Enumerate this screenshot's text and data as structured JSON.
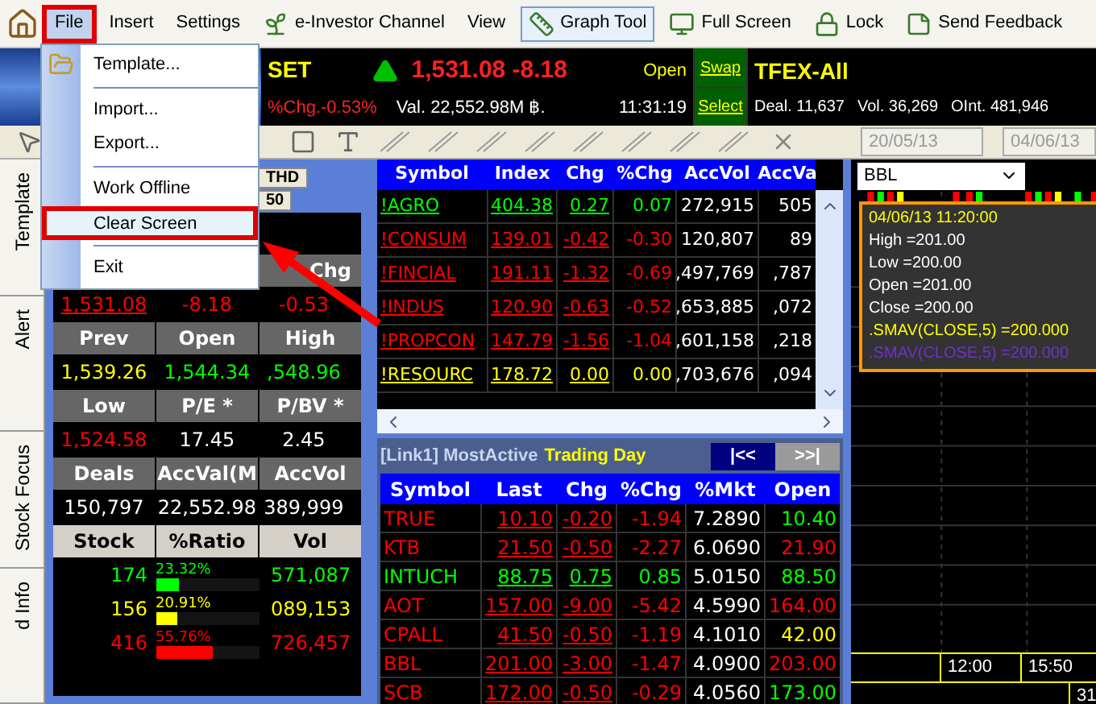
{
  "menu_bar": [
    {
      "label": "File",
      "selected": true,
      "toggled": false
    },
    {
      "label": "Insert",
      "selected": false,
      "toggled": false
    },
    {
      "label": "Settings",
      "selected": false,
      "toggled": false
    },
    {
      "label": "e-Investor Channel",
      "selected": false,
      "toggled": false
    },
    {
      "label": "View",
      "selected": false,
      "toggled": false
    },
    {
      "label": "Graph Tool",
      "selected": false,
      "toggled": true
    },
    {
      "label": "Full Screen",
      "selected": false,
      "toggled": false
    },
    {
      "label": "Lock",
      "selected": false,
      "toggled": false
    },
    {
      "label": "Send Feedback",
      "selected": false,
      "toggled": false
    }
  ],
  "file_menu": [
    {
      "label": "Template...",
      "separator_before": false,
      "highlighted": false
    },
    {
      "label": "Import...",
      "separator_before": true,
      "highlighted": false
    },
    {
      "label": "Export...",
      "separator_before": false,
      "highlighted": false
    },
    {
      "label": "Work Offline",
      "separator_before": true,
      "highlighted": false
    },
    {
      "label": "Clear Screen",
      "separator_before": false,
      "highlighted": true
    },
    {
      "label": "Exit",
      "separator_before": true,
      "highlighted": false
    }
  ],
  "market": {
    "index_name": "SET",
    "last": "1,531.08 -8.18",
    "status": "Open",
    "pct_change": "%Chg.-0.53%",
    "value": "Val. 22,552.98M ฿.",
    "time": "11:31:19",
    "swap": "Swap",
    "select": "Select",
    "tfex_name": "TFEX-All",
    "deal": "Deal. 11,637",
    "volume": "Vol. 36,269",
    "open_interest": "OInt. 481,946"
  },
  "toolbar": {
    "date_from": "20/05/13",
    "date_to": "04/06/13"
  },
  "side_tabs": [
    "Template",
    "Alert",
    "Stock Focus",
    "d Info"
  ],
  "left_panel": {
    "tabs": [
      "THD",
      "50"
    ],
    "sections": [
      {
        "headers": [
          "Chg"
        ],
        "values": [
          {
            "text": "1,531.08",
            "color": "#ff0000",
            "underlined": true
          },
          {
            "text": "-8.18",
            "color": "#ff0000",
            "underlined": false
          },
          {
            "text": "-0.53",
            "color": "#ff0000",
            "underlined": false
          }
        ]
      },
      {
        "headers": [
          "Prev",
          "Open",
          "High"
        ],
        "values": [
          {
            "text": "1,539.26",
            "color": "#ffff00",
            "underlined": false
          },
          {
            "text": "1,544.34",
            "color": "#00ff00",
            "underlined": false
          },
          {
            "text": ",548.96",
            "color": "#00ff00",
            "underlined": false
          }
        ]
      },
      {
        "headers": [
          "Low",
          "P/E *",
          "P/BV *"
        ],
        "values": [
          {
            "text": "1,524.58",
            "color": "#ff0000",
            "underlined": false
          },
          {
            "text": "17.45",
            "color": "#ffffff",
            "underlined": false
          },
          {
            "text": "2.45",
            "color": "#ffffff",
            "underlined": false
          }
        ]
      },
      {
        "headers": [
          "Deals",
          "AccVal(M",
          "AccVol"
        ],
        "values": [
          {
            "text": "150,797",
            "color": "#ffffff",
            "underlined": false
          },
          {
            "text": "22,552.98",
            "color": "#ffffff",
            "underlined": false
          },
          {
            "text": "389,999",
            "color": "#ffffff",
            "underlined": false
          }
        ]
      }
    ],
    "breadth": {
      "columns": [
        "Stock",
        "%Ratio",
        "Vol"
      ],
      "rows": [
        {
          "stock": "174",
          "ratio": "23.32%",
          "level": 0.2332,
          "vol": "571,087",
          "color": "#00ff00"
        },
        {
          "stock": "156",
          "ratio": "20.91%",
          "level": 0.2091,
          "vol": "089,153",
          "color": "#ffff00"
        },
        {
          "stock": "416",
          "ratio": "55.76%",
          "level": 0.5576,
          "vol": "726,457",
          "color": "#ff0000"
        }
      ]
    }
  },
  "index_table": {
    "columns": [
      "Symbol",
      "Index",
      "Chg",
      "%Chg",
      "AccVol",
      "AccVa"
    ],
    "rows": [
      {
        "color": "#00ff00",
        "cells": [
          "!AGRO",
          "404.38",
          "0.27",
          "0.07",
          "272,915",
          "505"
        ]
      },
      {
        "color": "#ff0000",
        "cells": [
          "!CONSUM",
          "139.01",
          "-0.42",
          "-0.30",
          "120,807",
          "89"
        ]
      },
      {
        "color": "#ff0000",
        "cells": [
          "!FINCIAL",
          "191.11",
          "-1.32",
          "-0.69",
          ",497,769",
          ",787"
        ]
      },
      {
        "color": "#ff0000",
        "cells": [
          "!INDUS",
          "120.90",
          "-0.63",
          "-0.52",
          ",653,885",
          ",072"
        ]
      },
      {
        "color": "#ff0000",
        "cells": [
          "!PROPCON",
          "147.79",
          "-1.56",
          "-1.04",
          ",601,158",
          ",218"
        ]
      },
      {
        "color": "#ffff00",
        "cells": [
          "!RESOURC",
          "178.72",
          "0.00",
          "0.00",
          ",703,676",
          ",094"
        ]
      }
    ]
  },
  "most_active": {
    "title": "[Link1] MostActive",
    "mode": "Trading Day",
    "nav": [
      "|<<",
      ">>|"
    ],
    "columns": [
      "Symbol",
      "Last",
      "Chg",
      "%Chg",
      "%Mkt",
      "Open"
    ],
    "rows": [
      {
        "color": "#ff0000",
        "cells": [
          "TRUE",
          "10.10",
          "-0.20",
          "-1.94",
          "7.2890"
        ],
        "open": {
          "text": "10.40",
          "color": "#00ff00"
        }
      },
      {
        "color": "#ff0000",
        "cells": [
          "KTB",
          "21.50",
          "-0.50",
          "-2.27",
          "6.0690"
        ],
        "open": {
          "text": "21.90",
          "color": "#ff0000"
        }
      },
      {
        "color": "#00ff00",
        "cells": [
          "INTUCH",
          "88.75",
          "0.75",
          "0.85",
          "5.0150"
        ],
        "open": {
          "text": "88.50",
          "color": "#00ff00"
        }
      },
      {
        "color": "#ff0000",
        "cells": [
          "AOT",
          "157.00",
          "-9.00",
          "-5.42",
          "4.5990"
        ],
        "open": {
          "text": "164.00",
          "color": "#ff0000"
        }
      },
      {
        "color": "#ff0000",
        "cells": [
          "CPALL",
          "41.50",
          "-0.50",
          "-1.19",
          "4.1010"
        ],
        "open": {
          "text": "42.00",
          "color": "#ffff00"
        }
      },
      {
        "color": "#ff0000",
        "cells": [
          "BBL",
          "201.00",
          "-3.00",
          "-1.47",
          "4.0900"
        ],
        "open": {
          "text": "203.00",
          "color": "#ff0000"
        }
      },
      {
        "color": "#ff0000",
        "cells": [
          "SCB",
          "172.00",
          "-0.50",
          "-0.29",
          "4.0560"
        ],
        "open": {
          "text": "173.00",
          "color": "#00ff00"
        }
      }
    ]
  },
  "chart": {
    "symbol": "BBL",
    "tooltip": [
      {
        "text": "04/06/13 11:20:00",
        "color": "#ffff00"
      },
      {
        "text": "High =201.00",
        "color": "#ffffff"
      },
      {
        "text": "Low =200.00",
        "color": "#ffffff"
      },
      {
        "text": "Open =201.00",
        "color": "#ffffff"
      },
      {
        "text": "Close =200.00",
        "color": "#ffffff"
      },
      {
        "text": ".SMAV(CLOSE,5) =200.000",
        "color": "#ffff00"
      },
      {
        "text": ".SMAV(CLOSE,5) =200.000",
        "color": "#7030d0"
      }
    ],
    "time_labels": [
      "12:00",
      "15:50"
    ],
    "bottom_label": "31"
  }
}
